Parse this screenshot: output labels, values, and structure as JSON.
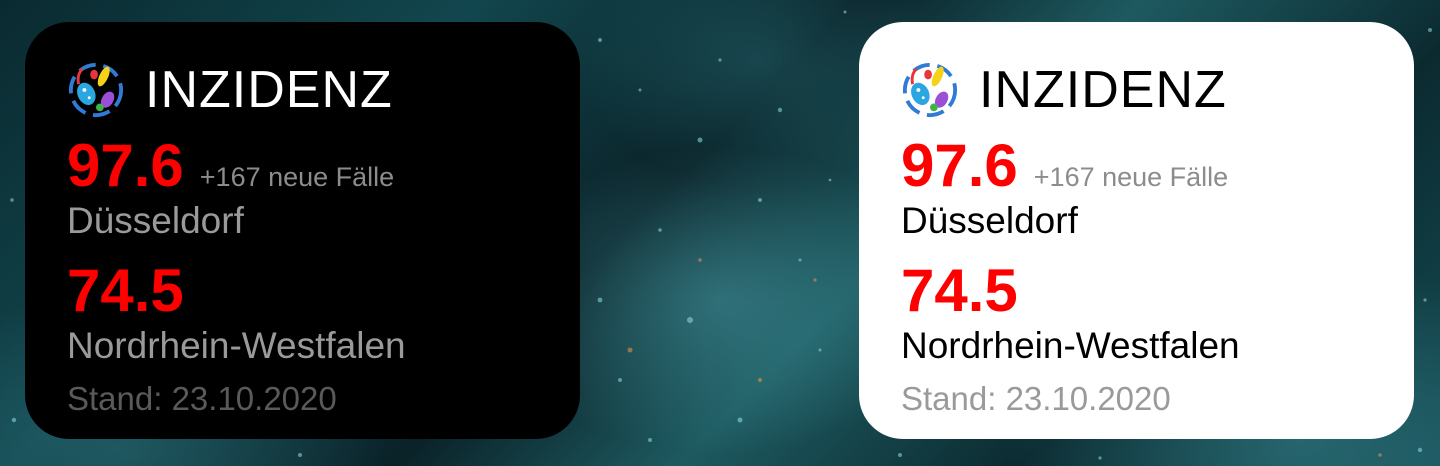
{
  "widgets": [
    {
      "theme": "dark",
      "icon": "virus-icon",
      "title": "INZIDENZ",
      "city_value": "97.6",
      "new_cases": "+167 neue Fälle",
      "city_name": "Düsseldorf",
      "state_value": "74.5",
      "state_name": "Nordrhein-Westfalen",
      "updated": "Stand: 23.10.2020"
    },
    {
      "theme": "light",
      "icon": "virus-icon",
      "title": "INZIDENZ",
      "city_value": "97.6",
      "new_cases": "+167 neue Fälle",
      "city_name": "Düsseldorf",
      "state_value": "74.5",
      "state_name": "Nordrhein-Westfalen",
      "updated": "Stand: 23.10.2020"
    }
  ],
  "colors": {
    "incidence_value": "#ff0000",
    "new_cases_text": "#8c8c8c",
    "dark_card_bg": "#000000",
    "light_card_bg": "#ffffff"
  }
}
